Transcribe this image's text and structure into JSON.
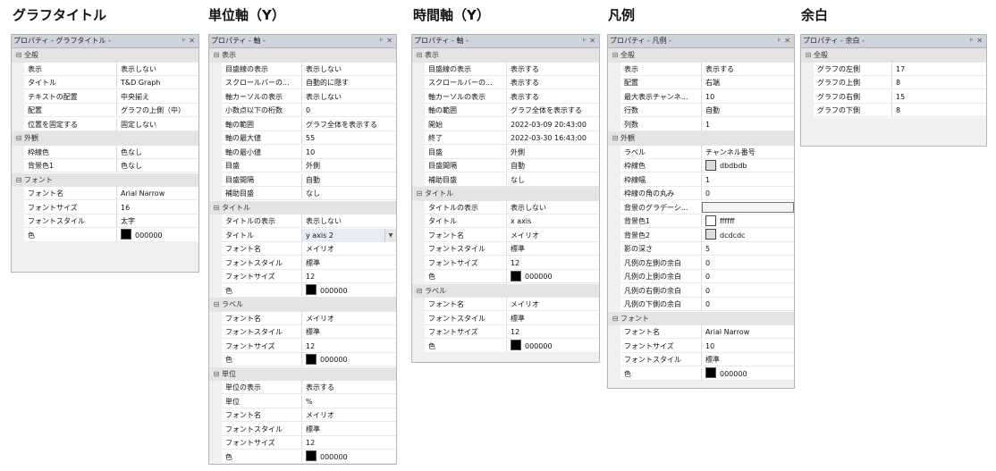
{
  "headings": [
    "グラフタイトル",
    "単位軸（Y）",
    "時間軸（Y）",
    "凡例",
    "余白"
  ],
  "panels": [
    {
      "title": "プロパティ - グラフタイトル -",
      "categories": [
        {
          "name": "全般",
          "rows": [
            {
              "name": "表示",
              "value": "表示しない"
            },
            {
              "name": "タイトル",
              "value": "T&D Graph"
            },
            {
              "name": "テキストの配置",
              "value": "中央揃え"
            },
            {
              "name": "配置",
              "value": "グラフの上側（中）"
            },
            {
              "name": "位置を固定する",
              "value": "固定しない"
            }
          ]
        },
        {
          "name": "外観",
          "rows": [
            {
              "name": "枠線色",
              "value": "色なし"
            },
            {
              "name": "背景色1",
              "value": "色なし"
            }
          ]
        },
        {
          "name": "フォント",
          "rows": [
            {
              "name": "フォント名",
              "value": "Arial Narrow"
            },
            {
              "name": "フォントサイズ",
              "value": "16"
            },
            {
              "name": "フォントスタイル",
              "value": "太字"
            },
            {
              "name": "色",
              "value": "000000",
              "swatch": "#000000"
            }
          ]
        }
      ]
    },
    {
      "title": "プロパティ - 軸 -",
      "categories": [
        {
          "name": "表示",
          "rows": [
            {
              "name": "目盛線の表示",
              "value": "表示しない"
            },
            {
              "name": "スクロールバーの...",
              "value": "自動的に隠す"
            },
            {
              "name": "軸カーソルの表示",
              "value": "表示しない"
            },
            {
              "name": "小数点以下の桁数",
              "value": "0"
            },
            {
              "name": "軸の範囲",
              "value": "グラフ全体を表示する"
            },
            {
              "name": "軸の最大値",
              "value": "55"
            },
            {
              "name": "軸の最小値",
              "value": "10"
            },
            {
              "name": "目盛",
              "value": "外側"
            },
            {
              "name": "目盛間隔",
              "value": "自動"
            },
            {
              "name": "補助目盛",
              "value": "なし"
            }
          ]
        },
        {
          "name": "タイトル",
          "rows": [
            {
              "name": "タイトルの表示",
              "value": "表示しない"
            },
            {
              "name": "タイトル",
              "value": "y axis 2",
              "dropdown": true
            },
            {
              "name": "フォント名",
              "value": "メイリオ"
            },
            {
              "name": "フォントスタイル",
              "value": "標準"
            },
            {
              "name": "フォントサイズ",
              "value": "12"
            },
            {
              "name": "色",
              "value": "000000",
              "swatch": "#000000"
            }
          ]
        },
        {
          "name": "ラベル",
          "rows": [
            {
              "name": "フォント名",
              "value": "メイリオ"
            },
            {
              "name": "フォントスタイル",
              "value": "標準"
            },
            {
              "name": "フォントサイズ",
              "value": "12"
            },
            {
              "name": "色",
              "value": "000000",
              "swatch": "#000000"
            }
          ]
        },
        {
          "name": "単位",
          "rows": [
            {
              "name": "単位の表示",
              "value": "表示する"
            },
            {
              "name": "単位",
              "value": "%"
            },
            {
              "name": "フォント名",
              "value": "メイリオ"
            },
            {
              "name": "フォントスタイル",
              "value": "標準"
            },
            {
              "name": "フォントサイズ",
              "value": "12"
            },
            {
              "name": "色",
              "value": "000000",
              "swatch": "#000000"
            }
          ]
        }
      ]
    },
    {
      "title": "プロパティ - 軸 -",
      "categories": [
        {
          "name": "表示",
          "rows": [
            {
              "name": "目盛線の表示",
              "value": "表示する"
            },
            {
              "name": "スクロールバーの...",
              "value": "表示する"
            },
            {
              "name": "軸カーソルの表示",
              "value": "表示する"
            },
            {
              "name": "軸の範囲",
              "value": "グラフ全体を表示する"
            },
            {
              "name": "開始",
              "value": "2022-03-09 20:43:00"
            },
            {
              "name": "終了",
              "value": "2022-03-30 16:43:00"
            },
            {
              "name": "目盛",
              "value": "外側"
            },
            {
              "name": "目盛間隔",
              "value": "自動"
            },
            {
              "name": "補助目盛",
              "value": "なし"
            }
          ]
        },
        {
          "name": "タイトル",
          "rows": [
            {
              "name": "タイトルの表示",
              "value": "表示しない"
            },
            {
              "name": "タイトル",
              "value": "x axis"
            },
            {
              "name": "フォント名",
              "value": "メイリオ"
            },
            {
              "name": "フォントスタイル",
              "value": "標準"
            },
            {
              "name": "フォントサイズ",
              "value": "12"
            },
            {
              "name": "色",
              "value": "000000",
              "swatch": "#000000"
            }
          ]
        },
        {
          "name": "ラベル",
          "rows": [
            {
              "name": "フォント名",
              "value": "メイリオ"
            },
            {
              "name": "フォントスタイル",
              "value": "標準"
            },
            {
              "name": "フォントサイズ",
              "value": "12"
            },
            {
              "name": "色",
              "value": "000000",
              "swatch": "#000000"
            }
          ]
        }
      ]
    },
    {
      "title": "プロパティ - 凡例 -",
      "categories": [
        {
          "name": "全般",
          "rows": [
            {
              "name": "表示",
              "value": "表示する"
            },
            {
              "name": "配置",
              "value": "右端"
            },
            {
              "name": "最大表示チャンネ...",
              "value": "10"
            },
            {
              "name": "行数",
              "value": "自動"
            },
            {
              "name": "列数",
              "value": "1"
            }
          ]
        },
        {
          "name": "外観",
          "rows": [
            {
              "name": "ラベル",
              "value": "チャンネル番号"
            },
            {
              "name": "枠線色",
              "value": "dbdbdb",
              "swatch": "#dbdbdb"
            },
            {
              "name": "枠線幅",
              "value": "1"
            },
            {
              "name": "枠線の角の丸み",
              "value": "0"
            },
            {
              "name": "背景のグラデーシ...",
              "value": "",
              "gradbox": true
            },
            {
              "name": "背景色1",
              "value": "ffffff",
              "swatch": "#ffffff"
            },
            {
              "name": "背景色2",
              "value": "dcdcdc",
              "swatch": "#dcdcdc"
            },
            {
              "name": "影の深さ",
              "value": "5"
            },
            {
              "name": "凡例の左側の余白",
              "value": "0"
            },
            {
              "name": "凡例の上側の余白",
              "value": "0"
            },
            {
              "name": "凡例の右側の余白",
              "value": "0"
            },
            {
              "name": "凡例の下側の余白",
              "value": "0"
            }
          ]
        },
        {
          "name": "フォント",
          "rows": [
            {
              "name": "フォント名",
              "value": "Arial Narrow"
            },
            {
              "name": "フォントサイズ",
              "value": "10"
            },
            {
              "name": "フォントスタイル",
              "value": "標準"
            },
            {
              "name": "色",
              "value": "000000",
              "swatch": "#000000"
            }
          ]
        }
      ]
    },
    {
      "title": "プロパティ - 余白 -",
      "categories": [
        {
          "name": "全般",
          "rows": [
            {
              "name": "グラフの左側",
              "value": "17"
            },
            {
              "name": "グラフの上側",
              "value": "8"
            },
            {
              "name": "グラフの右側",
              "value": "15"
            },
            {
              "name": "グラフの下側",
              "value": "8"
            }
          ]
        }
      ]
    }
  ],
  "titlebar_buttons": {
    "pin": "ᵖ",
    "close": "✕"
  },
  "expander_glyph": "⊟"
}
